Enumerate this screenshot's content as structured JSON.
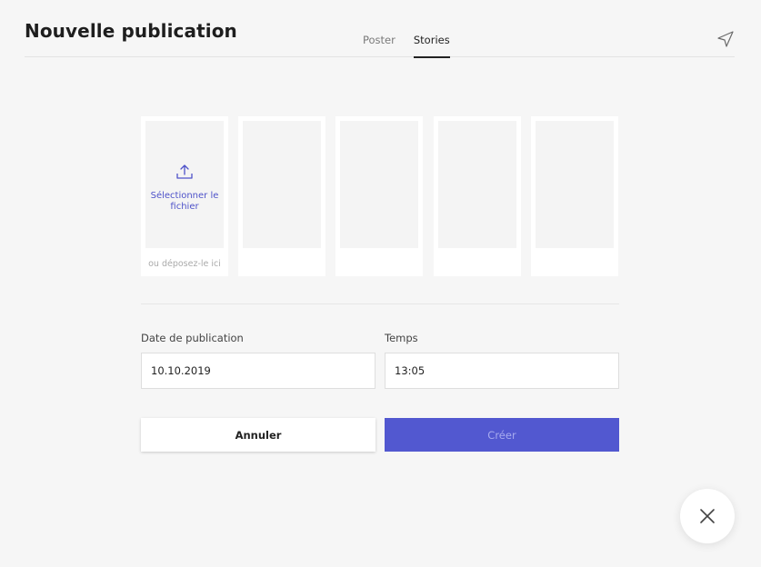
{
  "header": {
    "title": "Nouvelle publication",
    "tabs": [
      {
        "label": "Poster",
        "active": false
      },
      {
        "label": "Stories",
        "active": true
      }
    ],
    "send_icon": "paper-plane-icon"
  },
  "stories": {
    "upload_label": "Sélectionner le fichier",
    "drop_hint": "ou déposez-le ici",
    "upload_icon": "upload-icon",
    "slot_count": 5
  },
  "form": {
    "date": {
      "label": "Date de publication",
      "value": "10.10.2019"
    },
    "time": {
      "label": "Temps",
      "value": "13:05"
    }
  },
  "actions": {
    "cancel_label": "Annuler",
    "create_label": "Créer"
  },
  "close_icon": "close-icon",
  "colors": {
    "accent": "#5258d0",
    "accent_text_disabled": "#a8acef",
    "link": "#4e52c9",
    "background": "#f6f6f6"
  }
}
